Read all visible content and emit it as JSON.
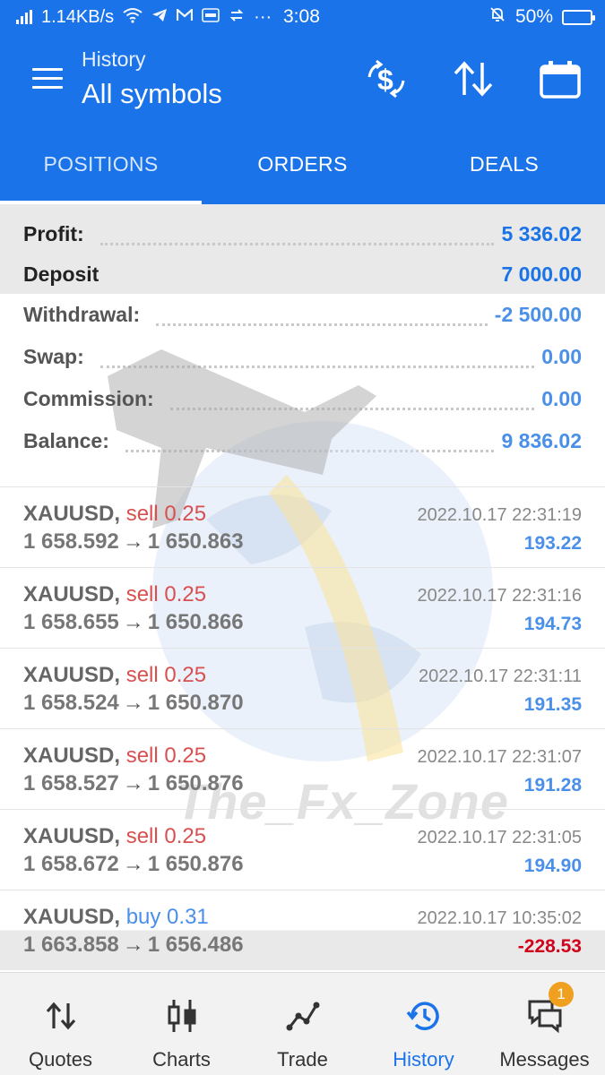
{
  "status_bar": {
    "network_speed": "1.14KB/s",
    "time": "3:08",
    "battery": "50%",
    "battery_level": 0.5,
    "more": "···"
  },
  "header": {
    "subtitle": "History",
    "title": "All symbols"
  },
  "tabs": [
    {
      "label": "POSITIONS",
      "active": true
    },
    {
      "label": "ORDERS",
      "active": false
    },
    {
      "label": "DEALS",
      "active": false
    }
  ],
  "summary": [
    {
      "label": "Profit:",
      "value": "5 336.02"
    },
    {
      "label": "Deposit",
      "value": "7 000.00"
    },
    {
      "label": "Withdrawal:",
      "value": "-2 500.00"
    },
    {
      "label": "Swap:",
      "value": "0.00"
    },
    {
      "label": "Commission:",
      "value": "0.00"
    },
    {
      "label": "Balance:",
      "value": "9 836.02"
    }
  ],
  "deals": [
    {
      "symbol": "XAUUSD,",
      "side": "sell 0.25",
      "open": "1 658.592",
      "close": "1 650.863",
      "time": "2022.10.17 22:31:19",
      "profit": "193.22"
    },
    {
      "symbol": "XAUUSD,",
      "side": "sell 0.25",
      "open": "1 658.655",
      "close": "1 650.866",
      "time": "2022.10.17 22:31:16",
      "profit": "194.73"
    },
    {
      "symbol": "XAUUSD,",
      "side": "sell 0.25",
      "open": "1 658.524",
      "close": "1 650.870",
      "time": "2022.10.17 22:31:11",
      "profit": "191.35"
    },
    {
      "symbol": "XAUUSD,",
      "side": "sell 0.25",
      "open": "1 658.527",
      "close": "1 650.876",
      "time": "2022.10.17 22:31:07",
      "profit": "191.28"
    },
    {
      "symbol": "XAUUSD,",
      "side": "sell 0.25",
      "open": "1 658.672",
      "close": "1 650.876",
      "time": "2022.10.17 22:31:05",
      "profit": "194.90"
    },
    {
      "symbol": "XAUUSD,",
      "side": "buy 0.31",
      "open": "1 663.858",
      "close": "1 656.486",
      "time": "2022.10.17 10:35:02",
      "profit": "-228.53"
    }
  ],
  "arrow": "→",
  "watermark": "The_Fx_Zone",
  "bottom_nav": [
    {
      "label": "Quotes",
      "icon": "quotes-icon",
      "active": false
    },
    {
      "label": "Charts",
      "icon": "charts-icon",
      "active": false
    },
    {
      "label": "Trade",
      "icon": "trade-icon",
      "active": false
    },
    {
      "label": "History",
      "icon": "history-icon",
      "active": true
    },
    {
      "label": "Messages",
      "icon": "messages-icon",
      "active": false,
      "badge": "1"
    }
  ],
  "colors": {
    "primary": "#1a73e8",
    "sell": "#d85050",
    "buy": "#4a8fe8",
    "loss": "#d0021b",
    "badge": "#f0a020"
  }
}
